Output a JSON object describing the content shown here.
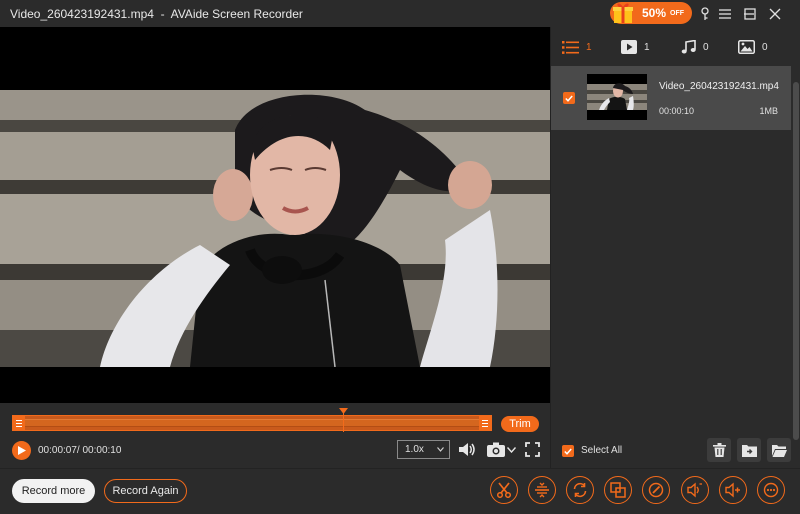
{
  "window": {
    "title": "Video_260423192431.mp4  -  AVAide Screen Recorder",
    "promo_text": "50%",
    "promo_off": "OFF"
  },
  "player": {
    "trim_label": "Trim",
    "time": "00:00:07/ 00:00:10",
    "speed": "1.0x"
  },
  "tabs": [
    {
      "icon": "list-icon",
      "count": "1"
    },
    {
      "icon": "video-icon",
      "count": "1"
    },
    {
      "icon": "audio-icon",
      "count": "0"
    },
    {
      "icon": "image-icon",
      "count": "0"
    }
  ],
  "files": [
    {
      "name": "Video_260423192431.mp4",
      "duration": "00:00:10",
      "size": "1MB",
      "checked": true
    }
  ],
  "panel": {
    "select_all": "Select All"
  },
  "bottom": {
    "record_more": "Record more",
    "record_again": "Record Again"
  },
  "tools": [
    "scissors-icon",
    "split-icon",
    "convert-icon",
    "merge-icon",
    "edit-icon",
    "volume-up-icon",
    "volume-boost-icon",
    "more-icon"
  ],
  "colors": {
    "accent": "#f26a1b",
    "background": "#2b2b2b",
    "selected_row": "#4a4a4a"
  }
}
